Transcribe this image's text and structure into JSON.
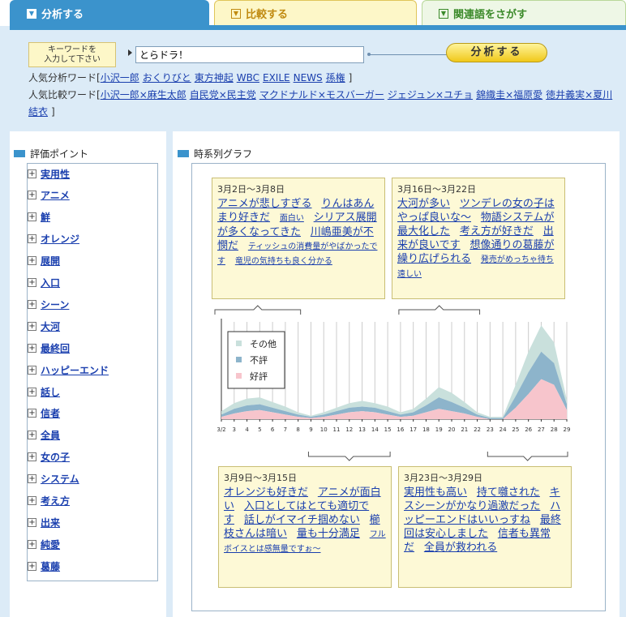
{
  "tabs": [
    {
      "label": "分析する",
      "active": true
    },
    {
      "label": "比較する",
      "active": false
    },
    {
      "label": "関連語をさがす",
      "active": false
    }
  ],
  "search": {
    "label_line1": "キーワードを",
    "label_line2": "入力して下さい",
    "value": "とらドラ！",
    "button": "分析する"
  },
  "popular_analysis": {
    "label": "人気分析ワード[",
    "close": "]",
    "words": [
      "小沢一郎",
      "おくりびと",
      "東方神起",
      "WBC",
      "EXILE",
      "NEWS",
      "孫権"
    ]
  },
  "popular_compare": {
    "label": "人気比較ワード[",
    "close": "]",
    "words": [
      "小沢一郎×麻生太郎",
      "自民党×民主党",
      "マクドナルド×モスバーガー",
      "ジェジュン×ユチョ",
      "錦織圭×福原愛",
      "徳井義実×夏川"
    ],
    "cont": "結衣"
  },
  "eval": {
    "title": "評価ポイント",
    "items": [
      "実用性",
      "アニメ",
      "鮮",
      "オレンジ",
      "展開",
      "入口",
      "シーン",
      "大河",
      "最終回",
      "ハッピーエンド",
      "話し",
      "信者",
      "全員",
      "女の子",
      "システム",
      "考え方",
      "出来",
      "純愛",
      "葛藤"
    ]
  },
  "graph": {
    "title": "時系列グラフ",
    "cards": [
      {
        "date": "3月2日～3月8日",
        "links": [
          {
            "t": "アニメが悲しすぎる",
            "s": "big"
          },
          {
            "t": "りんはあんまり好きだ",
            "s": "big"
          },
          {
            "t": "面白い",
            "s": "sm"
          },
          {
            "t": "シリアス展開が多くなってきた",
            "s": "big"
          },
          {
            "t": "川嶋亜美が不憫だ",
            "s": "big"
          },
          {
            "t": "ティッシュの消費量がやばかったです",
            "s": "sm"
          },
          {
            "t": "竜児の気持ちも良く分かる",
            "s": "sm"
          }
        ]
      },
      {
        "date": "3月16日～3月22日",
        "links": [
          {
            "t": "大河が多い",
            "s": "big"
          },
          {
            "t": "ツンデレの女の子はやっぱ良いな～",
            "s": "big"
          },
          {
            "t": "物語システムが最大化した",
            "s": "big"
          },
          {
            "t": "考え方が好きだ",
            "s": "big"
          },
          {
            "t": "出来が良いです",
            "s": "big"
          },
          {
            "t": "想像通りの葛藤が繰り広げられる",
            "s": "big"
          },
          {
            "t": "発売がめっちゃ待ち遠しい",
            "s": "sm"
          }
        ]
      },
      {
        "date": "3月9日～3月15日",
        "links": [
          {
            "t": "オレンジも好きだ",
            "s": "big"
          },
          {
            "t": "アニメが面白い",
            "s": "big"
          },
          {
            "t": "入口としてはとても適切です",
            "s": "big"
          },
          {
            "t": "話しがイマイチ掴めない",
            "s": "big"
          },
          {
            "t": "櫛枝さんは暗い",
            "s": "big"
          },
          {
            "t": "量も十分満足",
            "s": "big"
          },
          {
            "t": "フルボイスとは感無量ですぉ～",
            "s": "sm"
          }
        ]
      },
      {
        "date": "3月23日～3月29日",
        "links": [
          {
            "t": "実用性も高い",
            "s": "big"
          },
          {
            "t": "持て囃された",
            "s": "big"
          },
          {
            "t": "キスシーンがかなり過激だった",
            "s": "big"
          },
          {
            "t": "ハッピーエンドはいいっすね",
            "s": "big"
          },
          {
            "t": "最終回は安心しました",
            "s": "big"
          },
          {
            "t": "信者も異常だ",
            "s": "big"
          },
          {
            "t": "全員が救われる",
            "s": "big"
          }
        ]
      }
    ]
  },
  "chart_data": {
    "type": "area",
    "title": "",
    "xlabel": "",
    "ylabel": "",
    "x": [
      "3/2",
      "3",
      "4",
      "5",
      "6",
      "7",
      "8",
      "9",
      "10",
      "11",
      "12",
      "13",
      "14",
      "15",
      "16",
      "17",
      "18",
      "19",
      "20",
      "21",
      "22",
      "23",
      "24",
      "25",
      "26",
      "27",
      "28",
      "29"
    ],
    "series": [
      {
        "name": "好評",
        "color": "#f7c5cc",
        "values": [
          2,
          5,
          7,
          8,
          6,
          4,
          2,
          1,
          2,
          4,
          6,
          7,
          6,
          4,
          2,
          3,
          6,
          9,
          7,
          5,
          2,
          0,
          0,
          10,
          22,
          35,
          30,
          8
        ]
      },
      {
        "name": "不評",
        "color": "#8db4cb",
        "values": [
          2,
          4,
          5,
          5,
          4,
          3,
          2,
          1,
          2,
          3,
          4,
          4,
          4,
          3,
          2,
          3,
          6,
          10,
          8,
          5,
          2,
          1,
          1,
          10,
          19,
          24,
          19,
          5
        ]
      },
      {
        "name": "その他",
        "color": "#c9e0dc",
        "values": [
          3,
          5,
          6,
          6,
          5,
          4,
          2,
          1,
          2,
          3,
          4,
          5,
          4,
          4,
          2,
          3,
          6,
          9,
          8,
          5,
          2,
          1,
          1,
          10,
          18,
          23,
          18,
          4
        ]
      }
    ],
    "stacked": true,
    "legend": "top-left",
    "grid": true
  }
}
